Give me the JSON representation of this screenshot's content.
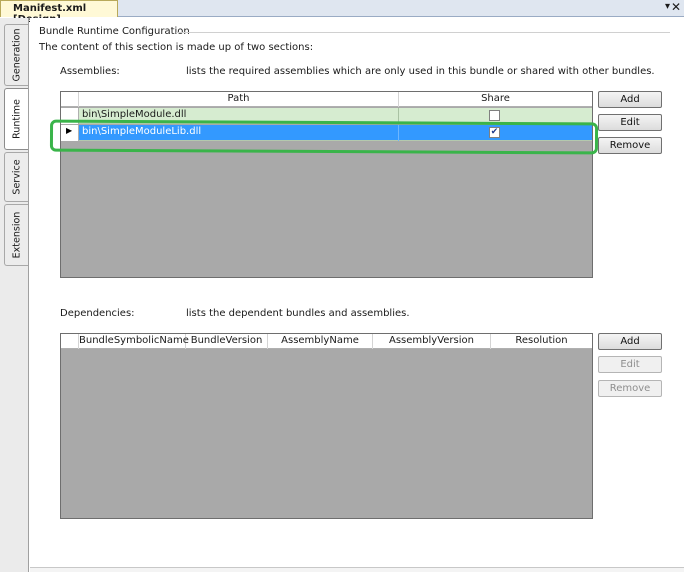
{
  "document_tab": {
    "title": "Manifest.xml [Design]",
    "dropdown_icon": "chevron-down-icon",
    "close_icon": "close-icon"
  },
  "side_tabs": [
    {
      "label": "Generation"
    },
    {
      "label": "Runtime"
    },
    {
      "label": "Service"
    },
    {
      "label": "Extension"
    }
  ],
  "active_side_tab": "Runtime",
  "section": {
    "title": "Bundle Runtime Configuration",
    "description": "The content of this section is made up of two sections:"
  },
  "assemblies": {
    "label": "Assemblies:",
    "description": "lists the required assemblies which are only used in this bundle or shared with other bundles.",
    "columns": [
      "Path",
      "Share"
    ],
    "rows": [
      {
        "path": "bin\\SimpleModule.dll",
        "share": false,
        "selected": false
      },
      {
        "path": "bin\\SimpleModuleLib.dll",
        "share": true,
        "selected": true
      }
    ],
    "buttons": {
      "add": "Add",
      "edit": "Edit",
      "remove": "Remove"
    }
  },
  "dependencies": {
    "label": "Dependencies:",
    "description": "lists the dependent bundles and assemblies.",
    "columns": [
      "BundleSymbolicName",
      "BundleVersion",
      "AssemblyName",
      "AssemblyVersion",
      "Resolution"
    ],
    "buttons": {
      "add": "Add",
      "edit": "Edit",
      "remove": "Remove"
    }
  },
  "colors": {
    "row_background": "#d6ecd0",
    "selected_row": "#3399ff",
    "grid_empty_area": "#a9a9a9",
    "annotation_outline": "#3ab44a"
  }
}
